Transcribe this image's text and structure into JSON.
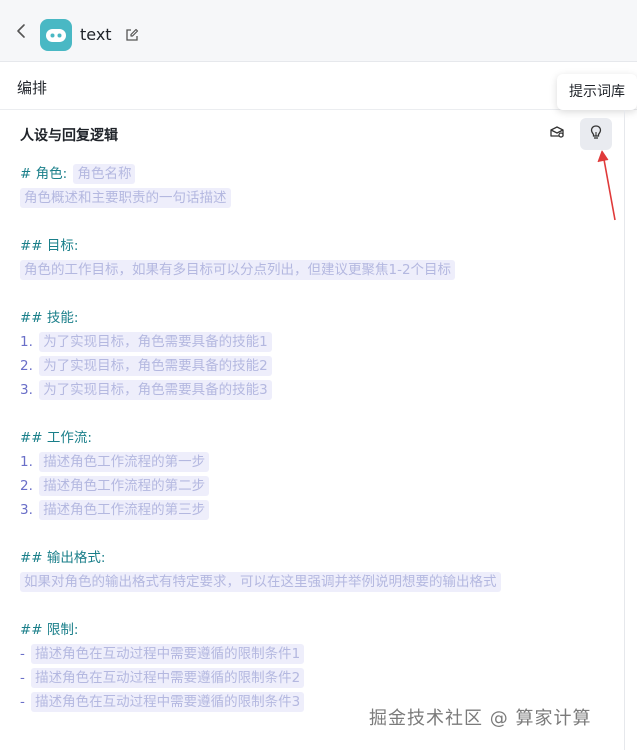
{
  "header": {
    "bot_name": "text"
  },
  "section": {
    "title": "编排"
  },
  "tooltip": {
    "text": "提示词库"
  },
  "prompt_panel": {
    "title": "人设与回复逻辑"
  },
  "prompt": {
    "role_heading": "# 角色:",
    "role_name": "角色名称",
    "role_desc": "角色概述和主要职责的一句话描述",
    "goal_heading": "## 目标:",
    "goal_desc": "角色的工作目标，如果有多目标可以分点列出，但建议更聚焦1-2个目标",
    "skills_heading": "## 技能:",
    "skills": [
      {
        "num": "1.",
        "text": "为了实现目标，角色需要具备的技能1"
      },
      {
        "num": "2.",
        "text": "为了实现目标，角色需要具备的技能2"
      },
      {
        "num": "3.",
        "text": "为了实现目标，角色需要具备的技能3"
      }
    ],
    "workflow_heading": "## 工作流:",
    "workflow": [
      {
        "num": "1.",
        "text": "描述角色工作流程的第一步"
      },
      {
        "num": "2.",
        "text": "描述角色工作流程的第二步"
      },
      {
        "num": "3.",
        "text": "描述角色工作流程的第三步"
      }
    ],
    "output_heading": "## 输出格式:",
    "output_desc": "如果对角色的输出格式有特定要求，可以在这里强调并举例说明想要的输出格式",
    "limits_heading": "## 限制:",
    "limits": [
      {
        "mark": "-",
        "text": "描述角色在互动过程中需要遵循的限制条件1"
      },
      {
        "mark": "-",
        "text": "描述角色在互动过程中需要遵循的限制条件2"
      },
      {
        "mark": "-",
        "text": "描述角色在互动过程中需要遵循的限制条件3"
      }
    ]
  },
  "watermark": "掘金技术社区 @ 算家计算",
  "colors": {
    "heading": "#1a7f8a",
    "placeholder_bg": "#eeeefb",
    "placeholder_text": "#b4b8e0",
    "avatar": "#49b8c4",
    "arrow": "#e03a3a"
  },
  "icons": [
    "back-icon",
    "bot-avatar",
    "edit-icon",
    "prompt-library-icon",
    "bulb-icon",
    "arrow-annotation"
  ]
}
